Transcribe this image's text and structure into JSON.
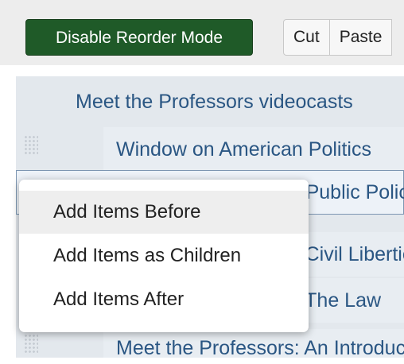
{
  "toolbar": {
    "reorder_label": "Disable Reorder Mode",
    "cut_label": "Cut",
    "paste_label": "Paste"
  },
  "tree": {
    "parent_title": "Meet the Professors videocasts",
    "items": [
      {
        "title": "Window on American Politics"
      },
      {
        "title": "Meet the Professors: Public Policy"
      },
      {
        "title": "Meet the Professors: Civil Liberties"
      },
      {
        "title": "Meet the Professors: The Law"
      },
      {
        "title": "Meet the Professors: An Introduction"
      }
    ]
  },
  "context_menu": {
    "items": [
      {
        "label": "Add Items Before"
      },
      {
        "label": "Add Items as Children"
      },
      {
        "label": "Add Items After"
      }
    ]
  }
}
